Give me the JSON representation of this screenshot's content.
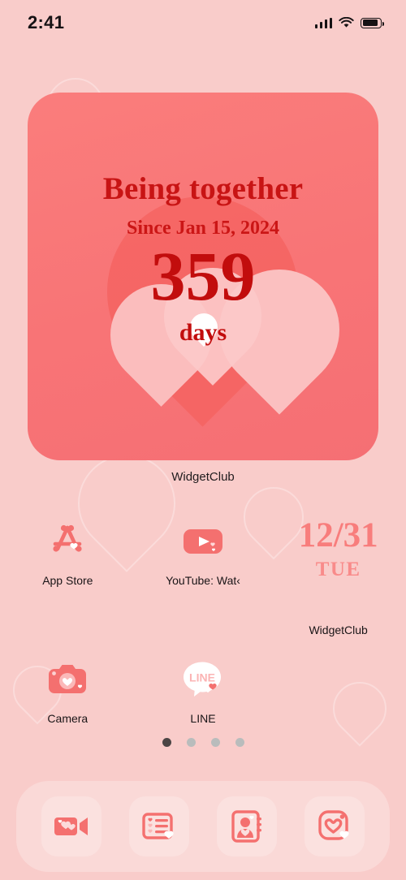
{
  "status_bar": {
    "time": "2:41",
    "signal_icon": "cellular-signal-icon",
    "wifi_icon": "wifi-icon",
    "battery_icon": "battery-icon"
  },
  "widget": {
    "title": "Being together",
    "since": "Since Jan 15, 2024",
    "count": "359",
    "unit": "days",
    "label": "WidgetClub",
    "colors": {
      "background": "#f87476",
      "title_text": "#c81414",
      "count_text": "#c20d0d",
      "heart_light": "#fbc0c0",
      "heart_dark": "#f4615f",
      "heart_white": "#ffffff"
    }
  },
  "apps": [
    {
      "name": "app-store",
      "label": "App Store",
      "icon": "app-store-icon"
    },
    {
      "name": "youtube",
      "label": "YouTube: Wat‹",
      "icon": "youtube-icon"
    },
    {
      "name": "camera",
      "label": "Camera",
      "icon": "camera-icon"
    },
    {
      "name": "line",
      "label": "LINE",
      "icon": "line-icon"
    }
  ],
  "date_widget": {
    "date": "12/31",
    "day_of_week": "TUE",
    "label": "WidgetClub",
    "color": "#f87d7c"
  },
  "page_dots": {
    "total": 4,
    "active_index": 0,
    "active_color": "#4c4545",
    "inactive_color": "#b9bcbc"
  },
  "dock": {
    "items": [
      {
        "name": "facetime",
        "icon": "video-camera-icon"
      },
      {
        "name": "notes",
        "icon": "notes-list-icon"
      },
      {
        "name": "contacts",
        "icon": "contacts-book-icon"
      },
      {
        "name": "photos",
        "icon": "heart-camera-icon"
      }
    ],
    "icon_color": "#f4706f"
  },
  "wallpaper": {
    "color": "#f9ccca"
  }
}
